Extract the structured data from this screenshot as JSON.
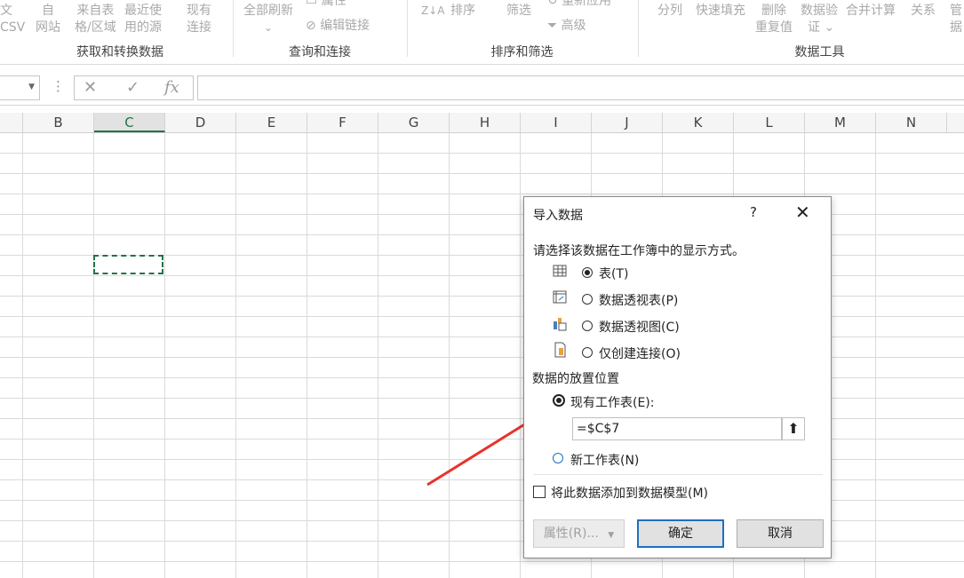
{
  "ribbon": {
    "group_get_transform": "获取和转换数据",
    "group_query": "查询和连接",
    "group_sort_filter": "排序和筛选",
    "group_data_tools": "数据工具",
    "items": {
      "from_text_1": "文",
      "from_text_2": "CSV",
      "from_web_1": "自",
      "from_web_2": "网站",
      "from_table_1": "来自表",
      "from_table_2": "格/区域",
      "recent_1": "最近使",
      "recent_2": "用的源",
      "existing_1": "现有",
      "existing_2": "连接",
      "refresh_all": "全部刷新",
      "refresh_all_dd": "⌄",
      "properties": "属性",
      "edit_links": "编辑链接",
      "sort": "排序",
      "sort_az_icon": "Z↓A",
      "filter": "筛选",
      "reapply": "重新应用",
      "advanced": "高级",
      "split": "分列",
      "flash_fill": "快速填充",
      "remove_dup_1": "删除",
      "remove_dup_2": "重复值",
      "validation_1": "数据验",
      "validation_2": "证 ⌄",
      "consolidate": "合并计算",
      "relations": "关系",
      "manage_1": "管",
      "manage_2": "据"
    }
  },
  "formula_bar": {
    "cancel": "✕",
    "enter": "✓",
    "fx": "fx",
    "dots": "⋮"
  },
  "columns": [
    "B",
    "C",
    "D",
    "E",
    "F",
    "G",
    "H",
    "I",
    "J",
    "K",
    "L",
    "M",
    "N"
  ],
  "dialog": {
    "title": "导入数据",
    "help": "?",
    "close": "✕",
    "prompt": "请选择该数据在工作簿中的显示方式。",
    "options": [
      {
        "label": "表(T)",
        "selected": true
      },
      {
        "label": "数据透视表(P)",
        "selected": false
      },
      {
        "label": "数据透视图(C)",
        "selected": false
      },
      {
        "label": "仅创建连接(O)",
        "selected": false
      }
    ],
    "placement_label": "数据的放置位置",
    "existing_sheet": "现有工作表(E):",
    "cell_ref": "=$C$7",
    "new_sheet": "新工作表(N)",
    "add_model": "将此数据添加到数据模型(M)",
    "properties_btn": "属性(R)...",
    "ok_btn": "确定",
    "cancel_btn": "取消"
  },
  "colors": {
    "accent": "#217346",
    "arrow": "#e8322b",
    "focus": "#1f6fbf"
  }
}
